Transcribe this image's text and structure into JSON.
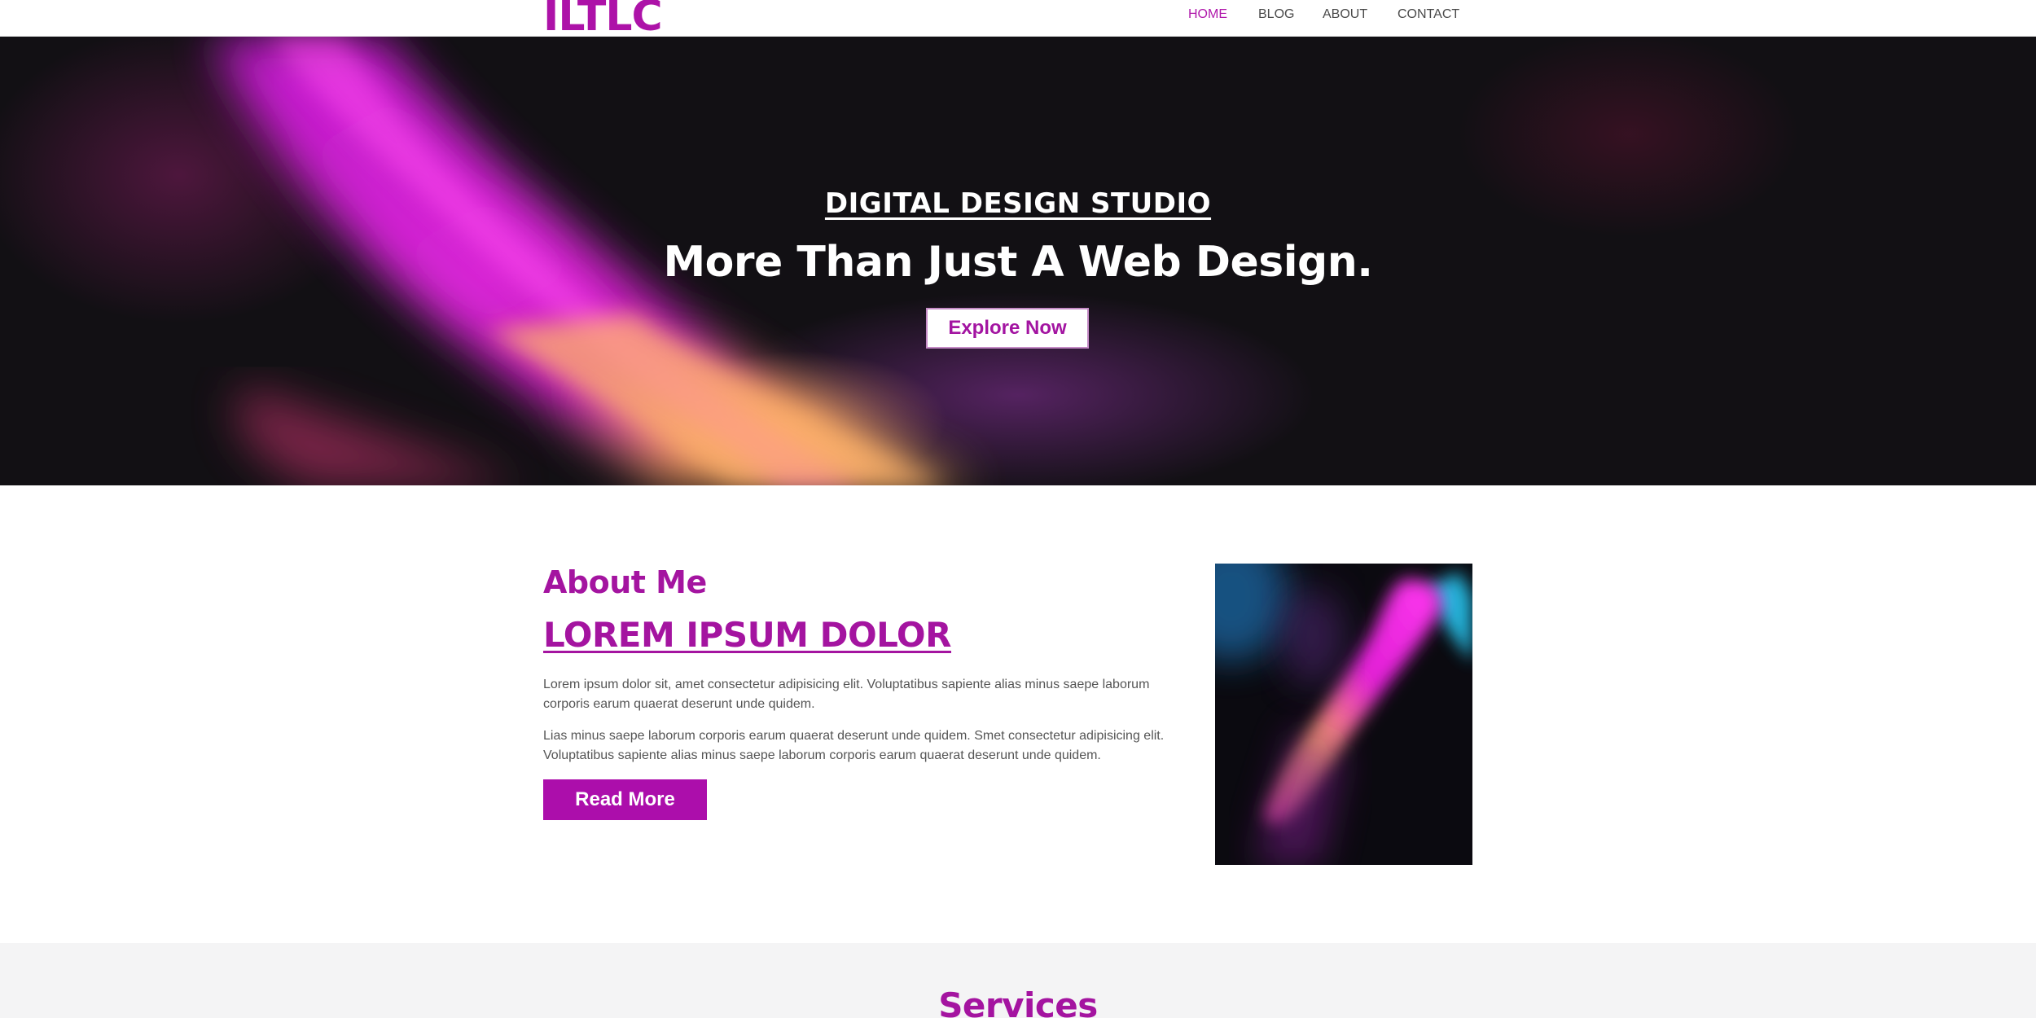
{
  "header": {
    "logo": "ILTLC",
    "nav": [
      {
        "label": "HOME",
        "active": true
      },
      {
        "label": "BLOG",
        "active": false
      },
      {
        "label": "ABOUT",
        "active": false
      },
      {
        "label": "CONTACT",
        "active": false
      }
    ]
  },
  "hero": {
    "kicker": "DIGITAL DESIGN STUDIO",
    "title": "More Than Just A Web Design.",
    "button_label": "Explore Now"
  },
  "about": {
    "heading": "About Me",
    "subheading": "LOREM IPSUM DOLOR",
    "paragraphs": [
      "Lorem ipsum dolor sit, amet consectetur adipisicing elit. Voluptatibus sapiente alias minus saepe laborum corporis earum quaerat deserunt unde quidem.",
      "Lias minus saepe laborum corporis earum quaerat deserunt unde quidem. Smet consectetur adipisicing elit. Voluptatibus sapiente alias minus saepe laborum corporis earum quaerat deserunt unde quidem."
    ],
    "button_label": "Read More"
  },
  "services": {
    "title": "Services"
  },
  "colors": {
    "accent": "#ac0eab",
    "hero_background": "#121014",
    "services_background": "#f4f4f5"
  }
}
